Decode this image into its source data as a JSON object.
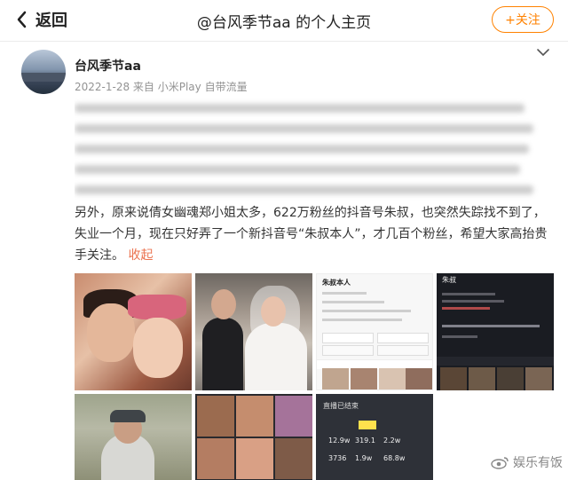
{
  "header": {
    "back_label": "返回",
    "title": "@台风季节aa 的个人主页",
    "follow_label": "+关注"
  },
  "post": {
    "username": "台风季节aa",
    "meta": "2022-1-28  来自 小米Play 自带流量",
    "text": "另外，原来说倩女幽魂郑小姐太多，622万粉丝的抖音号朱叔，也突然失踪找不到了，失业一个月，现在只好弄了一个新抖音号“朱叔本人”，才几百个粉丝，希望大家高抬贵手关注。",
    "expand_label": "收起"
  },
  "images": {
    "img3_title": "朱叔本人",
    "img4_title": "朱叔",
    "img7_title": "直播已结束"
  },
  "watermark": "娱乐有饭",
  "colors": {
    "accent": "#ff8200",
    "link": "#eb7350"
  }
}
